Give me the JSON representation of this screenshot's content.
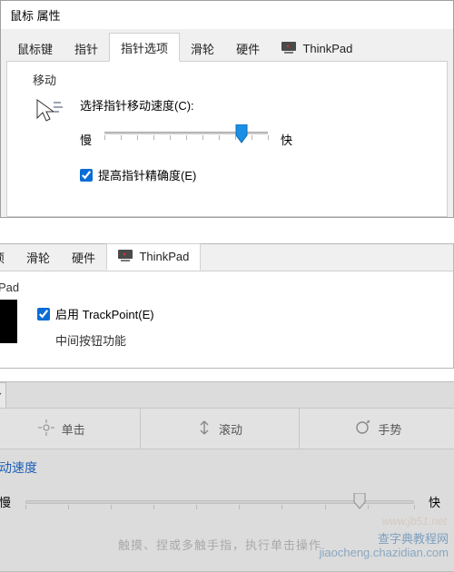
{
  "window1": {
    "title": "鼠标 属性",
    "tabs": [
      "鼠标键",
      "指针",
      "指针选项",
      "滑轮",
      "硬件",
      "ThinkPad"
    ],
    "active_tab_index": 2,
    "pointer_options": {
      "group_label": "移动",
      "speed_label": "选择指针移动速度(C):",
      "slow": "慢",
      "fast": "快",
      "enhance_precision": "提高指针精确度(E)",
      "enhance_checked": true,
      "slider_position_pct": 84
    }
  },
  "window2": {
    "tabs_visible": [
      "选项",
      "滑轮",
      "硬件",
      "ThinkPad"
    ],
    "active_tab_index": 3,
    "group_label": "uchPad",
    "enable_trackpoint": "启用 TrackPoint(E)",
    "enable_checked": true,
    "middle_button_label": "中间按钮功能"
  },
  "window3": {
    "buttons": [
      "单击",
      "滚动",
      "手势"
    ],
    "speed_section_label": "动速度",
    "slow": "慢",
    "fast": "快",
    "slider_position_pct": 86,
    "hint": "触摸、捏或多触手指，执行单击操作"
  },
  "watermark": {
    "small": "www.jb51.net",
    "cn_line": "查字典教程网",
    "url_line": "jiaocheng.chazidian.com"
  },
  "icons": {
    "thinkpad": "thinkpad-icon",
    "cursor": "cursor-icon",
    "click": "click-icon",
    "scroll": "scroll-icon",
    "gesture": "gesture-icon",
    "chevron": "chevron-down-icon"
  }
}
